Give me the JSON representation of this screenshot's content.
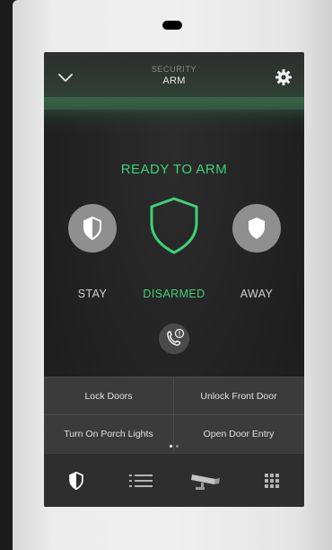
{
  "header": {
    "title": "SECURITY",
    "subtitle": "ARM",
    "back_icon": "chevron-down-icon",
    "settings_icon": "gear-icon"
  },
  "status": {
    "text": "READY TO ARM",
    "color": "#3ed17a"
  },
  "modes": {
    "stay_label": "STAY",
    "current_label": "DISARMED",
    "away_label": "AWAY"
  },
  "call_icon": "phone-alert-icon",
  "quick_actions": [
    {
      "label": "Lock Doors"
    },
    {
      "label": "Unlock Front Door"
    },
    {
      "label": "Turn On Porch Lights"
    },
    {
      "label": "Open Door Entry"
    }
  ],
  "pagination": {
    "current_page": 1,
    "page_count": 2
  },
  "bottom_nav": [
    {
      "icon": "shield-icon",
      "active": true
    },
    {
      "icon": "list-icon",
      "active": false
    },
    {
      "icon": "camera-icon",
      "active": false
    },
    {
      "icon": "grid-icon",
      "active": false
    }
  ]
}
